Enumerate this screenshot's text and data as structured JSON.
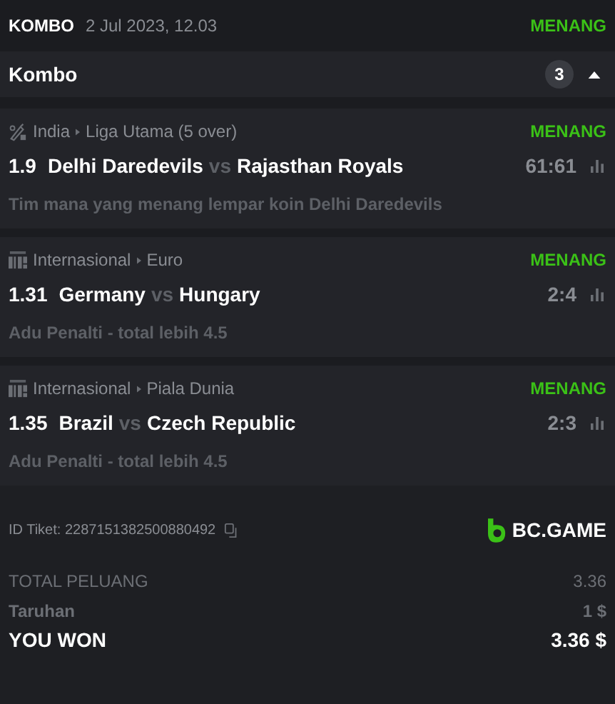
{
  "header": {
    "type": "KOMBO",
    "date": "2 Jul 2023, 12.03",
    "status": "MENANG"
  },
  "combo": {
    "title": "Kombo",
    "count": "3",
    "expanded": true
  },
  "bets": [
    {
      "kind": "cricket",
      "country": "India",
      "league": "Liga Utama (5 over)",
      "status": "MENANG",
      "odds": "1.9",
      "home": "Delhi Daredevils",
      "vs": "vs",
      "away": "Rajasthan Royals",
      "score": "61:61",
      "market": "Tim mana yang menang lempar koin Delhi Daredevils"
    },
    {
      "kind": "penalty",
      "country": "Internasional",
      "league": "Euro",
      "status": "MENANG",
      "odds": "1.31",
      "home": "Germany",
      "vs": "vs",
      "away": "Hungary",
      "score": "2:4",
      "market": "Adu Penalti - total lebih 4.5"
    },
    {
      "kind": "penalty",
      "country": "Internasional",
      "league": "Piala Dunia",
      "status": "MENANG",
      "odds": "1.35",
      "home": "Brazil",
      "vs": "vs",
      "away": "Czech Republic",
      "score": "2:3",
      "market": "Adu Penalti - total lebih 4.5"
    }
  ],
  "ticket": {
    "id": "ID Tiket: 2287151382500880492",
    "brand": "BC.GAME"
  },
  "summary": [
    {
      "kind": "odds",
      "label": "TOTAL PELUANG",
      "value": "3.36"
    },
    {
      "kind": "stake",
      "label": "Taruhan",
      "value": "1 $"
    },
    {
      "kind": "won",
      "label": "YOU WON",
      "value": "3.36 $"
    }
  ]
}
